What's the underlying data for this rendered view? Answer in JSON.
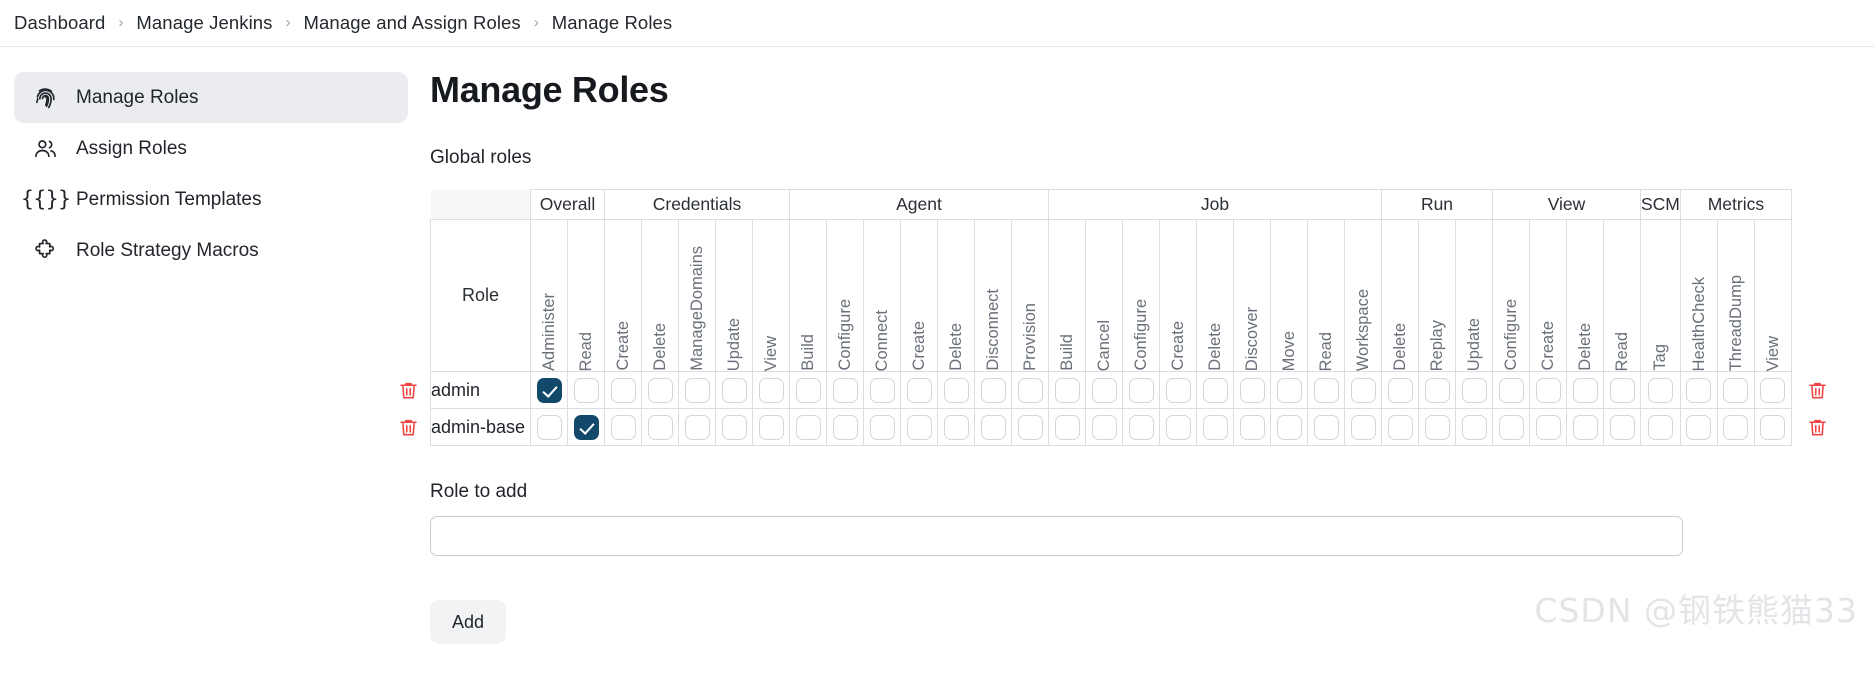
{
  "breadcrumb": {
    "items": [
      "Dashboard",
      "Manage Jenkins",
      "Manage and Assign Roles",
      "Manage Roles"
    ],
    "separator": "›"
  },
  "sidebar": {
    "items": [
      {
        "label": "Manage Roles",
        "icon": "fingerprint-icon",
        "active": true
      },
      {
        "label": "Assign Roles",
        "icon": "people-icon",
        "active": false
      },
      {
        "label": "Permission Templates",
        "icon": "braces-icon",
        "active": false
      },
      {
        "label": "Role Strategy Macros",
        "icon": "puzzle-piece-icon",
        "active": false
      }
    ]
  },
  "main": {
    "page_title": "Manage Roles",
    "section_label": "Global roles",
    "role_column_header": "Role",
    "role_to_add_label": "Role to add",
    "role_to_add_value": "",
    "role_to_add_placeholder": "",
    "add_button_label": "Add",
    "delete_icon": "trash-icon"
  },
  "table": {
    "groups": [
      {
        "name": "Overall",
        "span": 2
      },
      {
        "name": "Credentials",
        "span": 5
      },
      {
        "name": "Agent",
        "span": 7
      },
      {
        "name": "Job",
        "span": 9
      },
      {
        "name": "Run",
        "span": 3
      },
      {
        "name": "View",
        "span": 4
      },
      {
        "name": "SCM",
        "span": 1
      },
      {
        "name": "Metrics",
        "span": 3
      }
    ],
    "columns": [
      "Administer",
      "Read",
      "Create",
      "Delete",
      "ManageDomains",
      "Update",
      "View",
      "Build",
      "Configure",
      "Connect",
      "Create",
      "Delete",
      "Disconnect",
      "Provision",
      "Build",
      "Cancel",
      "Configure",
      "Create",
      "Delete",
      "Discover",
      "Move",
      "Read",
      "Workspace",
      "Delete",
      "Replay",
      "Update",
      "Configure",
      "Create",
      "Delete",
      "Read",
      "Tag",
      "HealthCheck",
      "ThreadDump",
      "View"
    ],
    "rows": [
      {
        "role": "admin",
        "checked": [
          true,
          false,
          false,
          false,
          false,
          false,
          false,
          false,
          false,
          false,
          false,
          false,
          false,
          false,
          false,
          false,
          false,
          false,
          false,
          false,
          false,
          false,
          false,
          false,
          false,
          false,
          false,
          false,
          false,
          false,
          false,
          false,
          false,
          false
        ]
      },
      {
        "role": "admin-base",
        "checked": [
          false,
          true,
          false,
          false,
          false,
          false,
          false,
          false,
          false,
          false,
          false,
          false,
          false,
          false,
          false,
          false,
          false,
          false,
          false,
          false,
          false,
          false,
          false,
          false,
          false,
          false,
          false,
          false,
          false,
          false,
          false,
          false,
          false,
          false
        ]
      }
    ]
  },
  "watermark": {
    "text": "CSDN @钢铁熊猫33"
  },
  "colors": {
    "checkbox_checked": "#12496b",
    "delete_icon": "#ef4444",
    "sidebar_active_bg": "#ebecf0",
    "table_header_bg": "#f6f7f9"
  }
}
